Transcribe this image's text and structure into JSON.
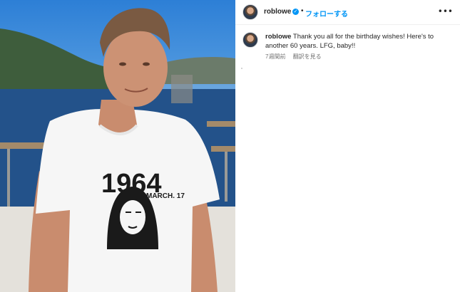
{
  "post": {
    "image_alt": "Man in white 1964 birthday T-shirt on a boat deck",
    "shirt_year": "1964",
    "shirt_date": "MARCH. 17"
  },
  "header": {
    "username": "roblowe",
    "separator": "•",
    "follow_label": "フォローする",
    "more_label": "•••",
    "verified_glyph": "✓"
  },
  "caption": {
    "username": "roblowe",
    "text": "Thank you all for the birthday wishes! Here's to another 60 years. LFG, baby!!"
  },
  "meta": {
    "time_ago": "7週間前",
    "translate_label": "翻訳を見る"
  },
  "colors": {
    "accent": "#0095f6",
    "text": "#262626",
    "muted": "#737373"
  }
}
